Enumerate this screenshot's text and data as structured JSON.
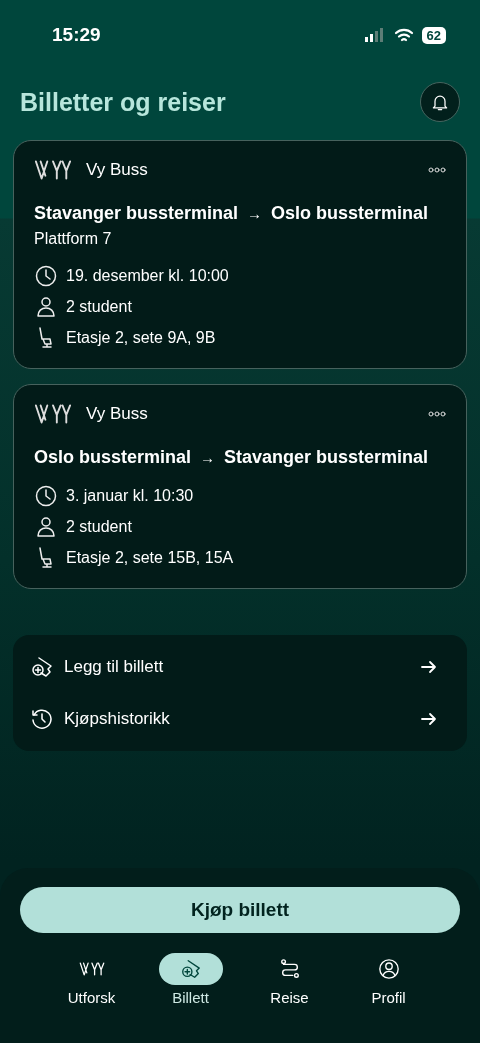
{
  "status_bar": {
    "time": "15:29",
    "battery": "62"
  },
  "title": "Billetter og reiser",
  "tickets": [
    {
      "operator": "Vy Buss",
      "from": "Stavanger bussterminal",
      "arrow": "→",
      "to": "Oslo bussterminal",
      "platform": "Plattform 7",
      "details": [
        {
          "kind": "time",
          "text": "19. desember kl. 10:00"
        },
        {
          "kind": "person",
          "text": "2 student"
        },
        {
          "kind": "seat",
          "text": "Etasje 2, sete 9A, 9B"
        }
      ]
    },
    {
      "operator": "Vy Buss",
      "from": "Oslo bussterminal",
      "arrow": "→",
      "to": "Stavanger bussterminal",
      "details": [
        {
          "kind": "time",
          "text": "3. januar kl. 10:30"
        },
        {
          "kind": "person",
          "text": "2 student"
        },
        {
          "kind": "seat",
          "text": "Etasje 2, sete 15B, 15A"
        }
      ]
    }
  ],
  "links": [
    {
      "kind": "add-ticket",
      "label": "Legg til billett"
    },
    {
      "kind": "history",
      "label": "Kjøpshistorikk"
    }
  ],
  "buy_button": "Kjøp billett",
  "nav": [
    {
      "kind": "logo",
      "label": "Utforsk",
      "selected": false
    },
    {
      "kind": "ticket",
      "label": "Billett",
      "selected": true
    },
    {
      "kind": "route",
      "label": "Reise",
      "selected": false
    },
    {
      "kind": "profile",
      "label": "Profil",
      "selected": false
    }
  ]
}
